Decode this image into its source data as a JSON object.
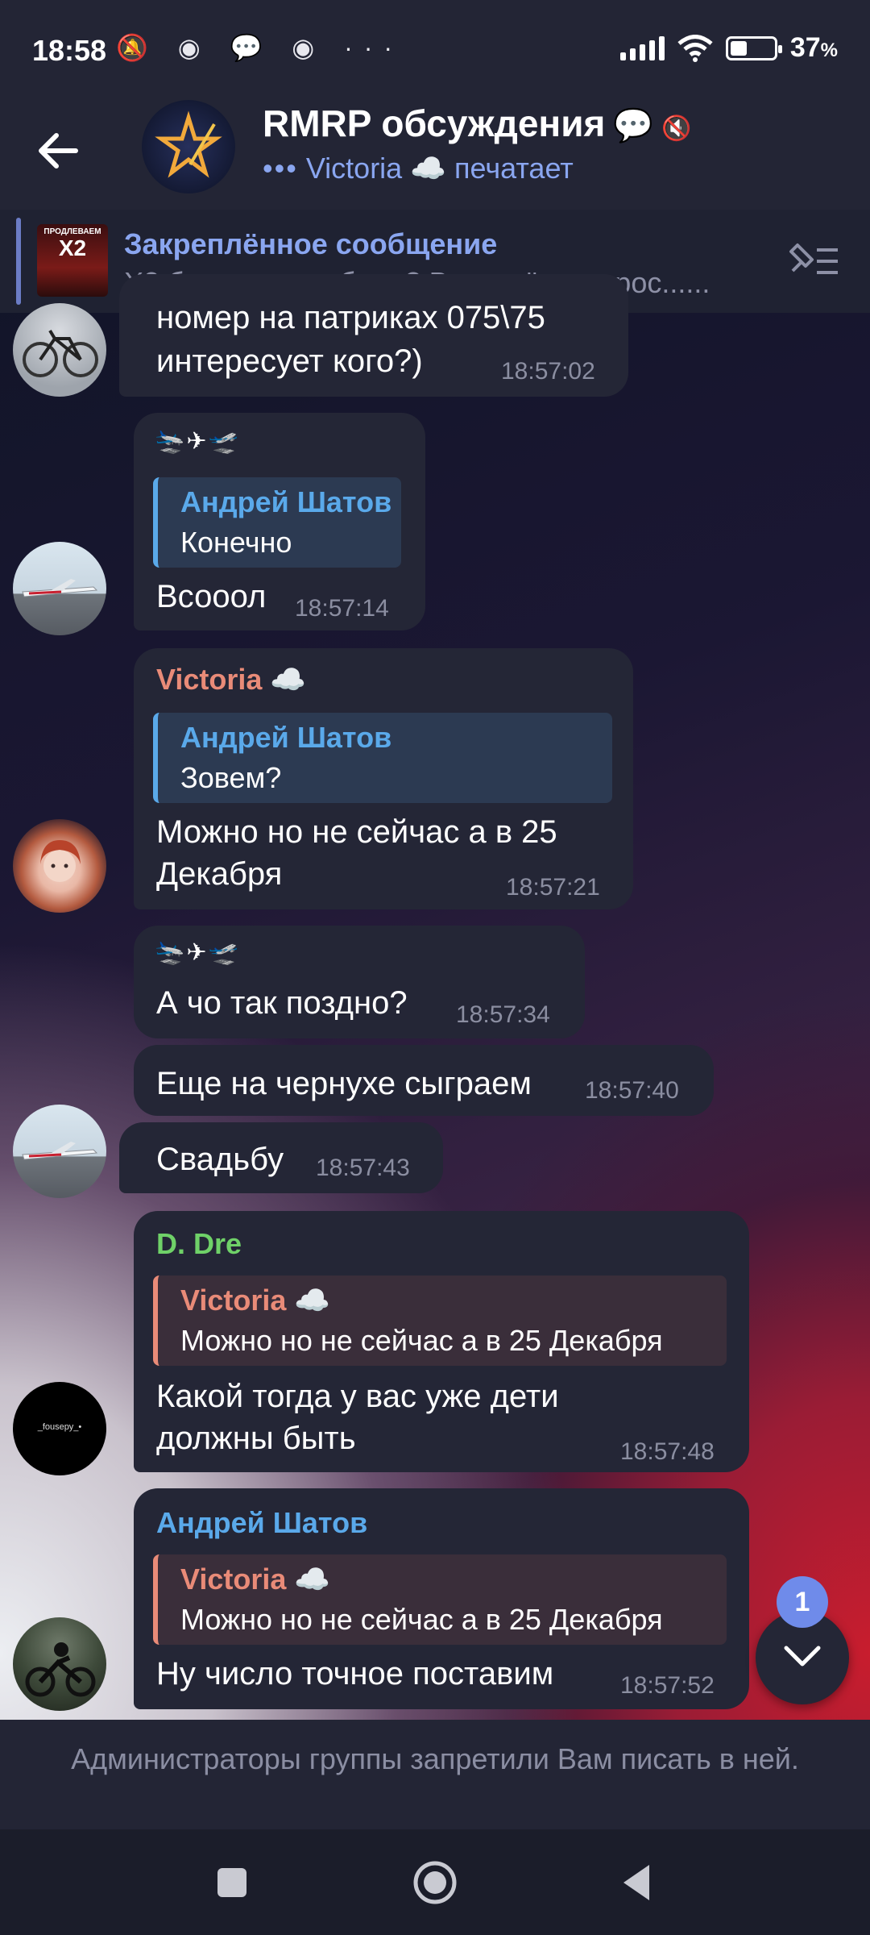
{
  "status_bar": {
    "time": "18:58",
    "notification_icons": [
      "bell-off-icon",
      "discord-icon",
      "chat-icon",
      "discord-icon",
      "more-icon"
    ],
    "notification_glyphs": "🔕 ◉ 💬 ◉ ···",
    "battery": "37",
    "battery_unit": "%"
  },
  "header": {
    "title": "RMRP обсуждения",
    "title_emoji": "💬",
    "title_mute_glyph": "🔇",
    "typing": "Victoria ☁️ печатает",
    "typing_dots": "•••"
  },
  "pinned": {
    "title": "Закреплённое сообщение",
    "text": "X2 быть или не быть?  Вот в чём вопрос......",
    "thumb_line1": "ПРОДЛЕВАЕМ",
    "thumb_line2": "X2"
  },
  "messages": {
    "m1": {
      "text": "номер на патриках 075\\75 интересует кого?)",
      "line1": "номер на патриках 075\\75",
      "line2": "интересует кого?)",
      "time": "18:57:02"
    },
    "m2": {
      "planes": "🛬✈🛫",
      "reply_name": "Андрей Шатов",
      "reply_text": "Конечно",
      "text": "Всооол",
      "time": "18:57:14"
    },
    "m3": {
      "sender": "Victoria ☁️",
      "reply_name": "Андрей Шатов",
      "reply_text": "Зовем?",
      "line1": "Можно но не сейчас а в 25",
      "line2": "Декабря",
      "time": "18:57:21"
    },
    "m4": {
      "planes": "🛬✈🛫",
      "text": "А чо так поздно?",
      "time": "18:57:34"
    },
    "m5": {
      "text": "Еще на чернухе сыграем",
      "time": "18:57:40"
    },
    "m6": {
      "text": "Свадьбу",
      "time": "18:57:43"
    },
    "m7": {
      "sender": "D. Dre",
      "reply_name": "Victoria ☁️",
      "reply_text": "Можно но не сейчас а в 25 Декабря",
      "line1": "Какой тогда у вас уже дети",
      "line2": "должны быть",
      "time": "18:57:48"
    },
    "m8": {
      "sender": "Андрей Шатов",
      "reply_name": "Victoria ☁️",
      "reply_text": "Можно но не сейчас а в 25 Декабря",
      "text": "Ну число точное поставим",
      "time": "18:57:52"
    }
  },
  "avatars": {
    "dre_label": "_fouseру_•"
  },
  "scroll_button": {
    "badge": "1"
  },
  "footer": {
    "text": "Администраторы группы запретили Вам писать в ней."
  },
  "colors": {
    "accent_blue": "#8aa6f0",
    "victoria_name": "#e98b78",
    "shatov_name": "#5aa9ea",
    "dre_name": "#6fd168",
    "bubble": "#242636"
  }
}
